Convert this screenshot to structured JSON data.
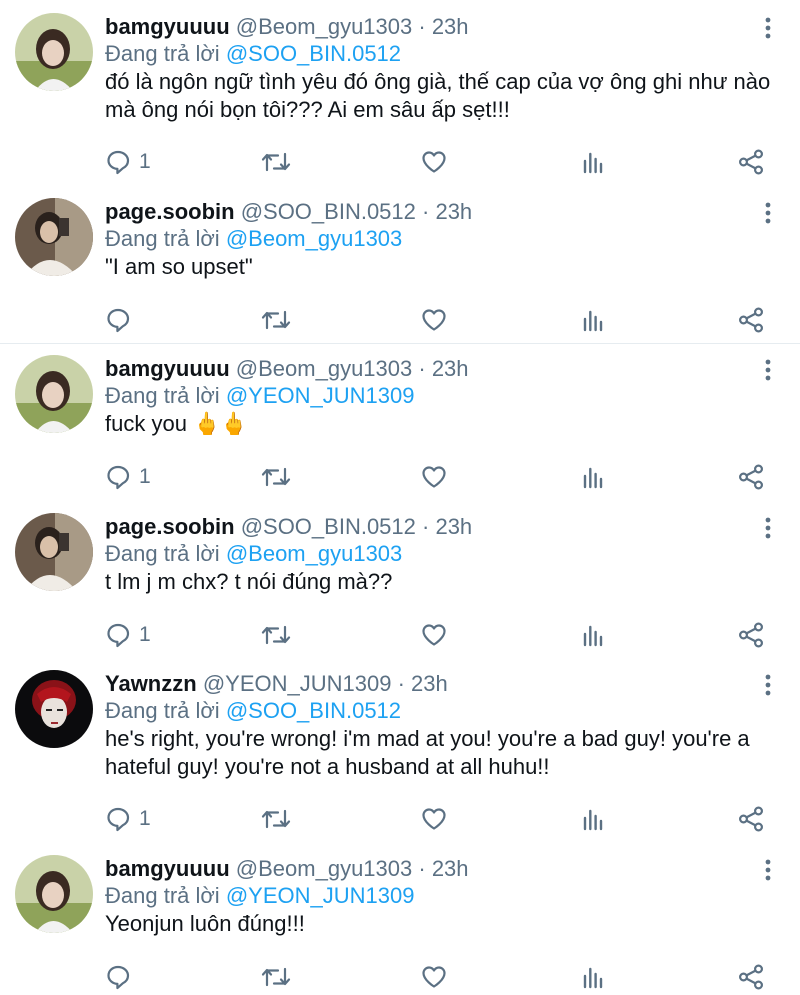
{
  "tweets": [
    {
      "name": "bamgyuuuu",
      "handle": "@Beom_gyu1303",
      "time": "· 23h",
      "replying_prefix": "Đang trả lời",
      "replying_to": "@SOO_BIN.0512",
      "text": "đó là ngôn ngữ tình yêu đó ông già, thế cap của vợ ông ghi như nào mà ông nói bọn tôi??? Ai em sâu ấp sẹt!!!",
      "reply_count": "1",
      "avatar": "bamgyu-avatar"
    },
    {
      "name": "page.soobin",
      "handle": "@SOO_BIN.0512",
      "time": "· 23h",
      "replying_prefix": "Đang trả lời",
      "replying_to": "@Beom_gyu1303",
      "text": "\"I am so upset\"",
      "reply_count": "",
      "avatar": "soobin-avatar"
    },
    {
      "name": "bamgyuuuu",
      "handle": "@Beom_gyu1303",
      "time": "· 23h",
      "replying_prefix": "Đang trả lời",
      "replying_to": "@YEON_JUN1309",
      "text": "fuck you 🖕🖕",
      "reply_count": "1",
      "avatar": "bamgyu-avatar"
    },
    {
      "name": "page.soobin",
      "handle": "@SOO_BIN.0512",
      "time": "· 23h",
      "replying_prefix": "Đang trả lời",
      "replying_to": "@Beom_gyu1303",
      "text": "t lm j m chx? t nói đúng mà??",
      "reply_count": "1",
      "avatar": "soobin-avatar"
    },
    {
      "name": "Yawnzzn",
      "handle": "@YEON_JUN1309",
      "time": "· 23h",
      "replying_prefix": "Đang trả lời",
      "replying_to": "@SOO_BIN.0512",
      "text": "he's right, you're wrong! i'm mad at you! you're a bad guy! you're a hateful guy! you're not a husband at all huhu!!",
      "reply_count": "1",
      "avatar": "yeonjun-avatar"
    },
    {
      "name": "bamgyuuuu",
      "handle": "@Beom_gyu1303",
      "time": "· 23h",
      "replying_prefix": "Đang trả lời",
      "replying_to": "@YEON_JUN1309",
      "text": "Yeonjun luôn đúng!!!",
      "reply_count": "",
      "avatar": "bamgyu-avatar"
    }
  ],
  "colors": {
    "mention": "#1da1f2",
    "muted": "#5b7083",
    "text": "#0f1419",
    "divider": "#e6ecf0"
  }
}
